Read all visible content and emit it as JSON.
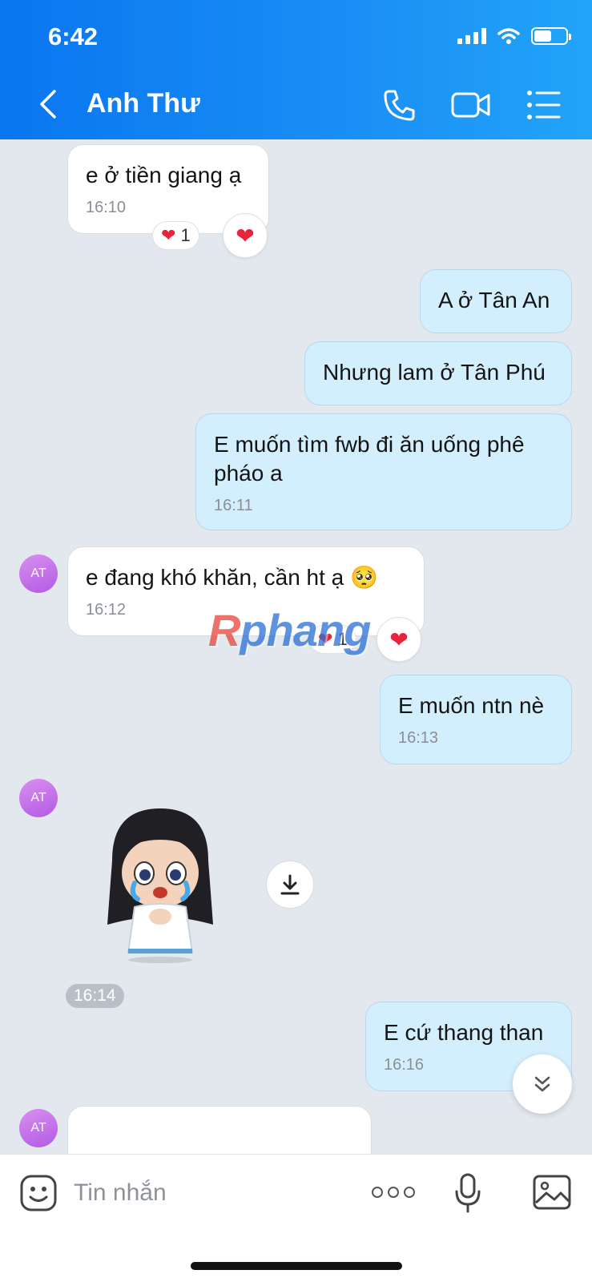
{
  "status_bar": {
    "time": "6:42"
  },
  "header": {
    "title": "Anh Thư"
  },
  "messages": [
    {
      "text": "e ở tiền giang ạ",
      "time": "16:10",
      "reaction_count": "1"
    },
    {
      "text": "A ở Tân An"
    },
    {
      "text": "Nhưng lam ở Tân Phú"
    },
    {
      "text": "E muốn tìm fwb đi ăn uống phê pháo a",
      "time": "16:11"
    },
    {
      "text": "e đang khó khăn, cần ht ạ 🥺",
      "time": "16:12",
      "reaction_count": "1"
    },
    {
      "text": "E muốn ntn nè",
      "time": "16:13"
    },
    {
      "time": "16:14"
    },
    {
      "text": "E cứ thang than",
      "time": "16:16"
    }
  ],
  "avatar_initials": "AT",
  "watermark": {
    "r": "R",
    "rest": "phang"
  },
  "input": {
    "placeholder": "Tin nhắn"
  },
  "colors": {
    "header": "#0a76f0",
    "outgoing_bubble": "#d3eefc",
    "incoming_bubble": "#ffffff",
    "background": "#e3e8ee"
  }
}
